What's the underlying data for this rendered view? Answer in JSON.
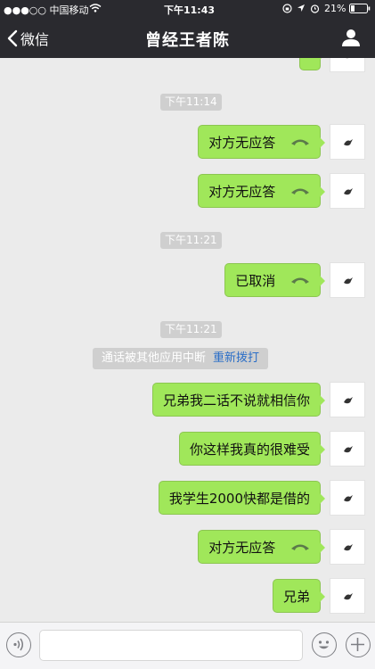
{
  "status_bar": {
    "carrier": "●●●○○ 中国移动",
    "time": "下午11:43",
    "battery": "21%"
  },
  "nav": {
    "back_label": "微信",
    "title": "曾经王者陈"
  },
  "timestamps": [
    "下午11:14",
    "下午11:21",
    "下午11:21"
  ],
  "system_note": {
    "text": "通话被其他应用中断",
    "action": "重新拨打"
  },
  "messages": [
    {
      "text": "对方无应答",
      "call": true
    },
    {
      "text": "对方无应答",
      "call": true
    },
    {
      "text": "已取消",
      "call": true
    },
    {
      "text": "兄弟我二话不说就相信你",
      "call": false
    },
    {
      "text": "你这样我真的很难受",
      "call": false
    },
    {
      "text": "我学生2000快都是借的",
      "call": false
    },
    {
      "text": "对方无应答",
      "call": true
    },
    {
      "text": "兄弟",
      "call": false
    }
  ],
  "input": {
    "value": "",
    "placeholder": ""
  },
  "icons": {
    "back": "chevron-left-icon",
    "contact": "person-icon",
    "voice": "voice-icon",
    "emoji": "emoji-icon",
    "plus": "plus-icon",
    "call": "phone-handset-icon"
  },
  "colors": {
    "bubble": "#a0e75a",
    "nav_bg": "#2a2a2f",
    "chat_bg": "#ebebeb",
    "link": "#2a6ec7"
  }
}
